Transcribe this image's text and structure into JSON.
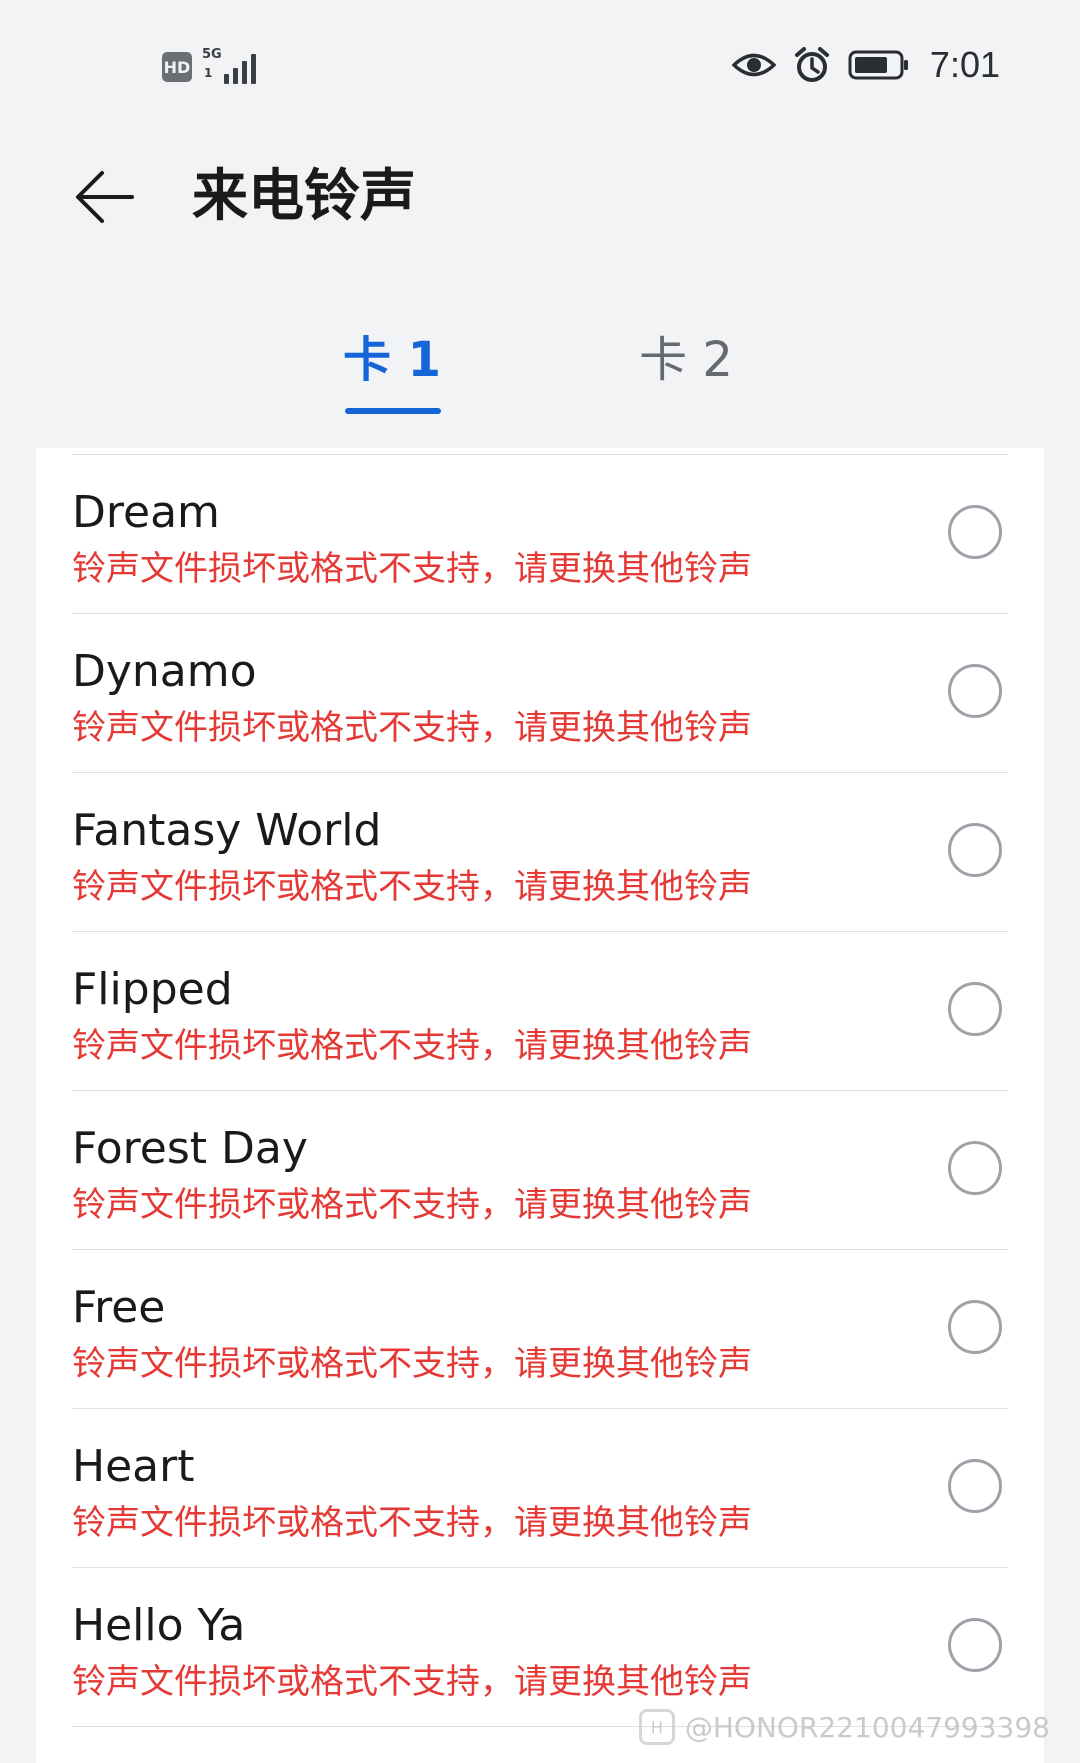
{
  "status_bar": {
    "hd_label": "HD",
    "network_label": "5G",
    "sim_label": "1",
    "time": "7:01",
    "icons": [
      "eye-icon",
      "alarm-icon",
      "battery-icon"
    ]
  },
  "header": {
    "title": "来电铃声",
    "back_icon": "arrow-left-icon"
  },
  "tabs": [
    {
      "label": "卡 1",
      "active": true
    },
    {
      "label": "卡 2",
      "active": false
    }
  ],
  "accent_color": "#1565d8",
  "error_color": "#e53935",
  "ringtones": [
    {
      "name": "Dream",
      "error": "铃声文件损坏或格式不支持，请更换其他铃声"
    },
    {
      "name": "Dynamo",
      "error": "铃声文件损坏或格式不支持，请更换其他铃声"
    },
    {
      "name": "Fantasy World",
      "error": "铃声文件损坏或格式不支持，请更换其他铃声"
    },
    {
      "name": "Flipped",
      "error": "铃声文件损坏或格式不支持，请更换其他铃声"
    },
    {
      "name": "Forest Day",
      "error": "铃声文件损坏或格式不支持，请更换其他铃声"
    },
    {
      "name": "Free",
      "error": "铃声文件损坏或格式不支持，请更换其他铃声"
    },
    {
      "name": "Heart",
      "error": "铃声文件损坏或格式不支持，请更换其他铃声"
    },
    {
      "name": "Hello Ya",
      "error": "铃声文件损坏或格式不支持，请更换其他铃声"
    }
  ],
  "watermark": {
    "text": "@HONOR2210047993398"
  }
}
